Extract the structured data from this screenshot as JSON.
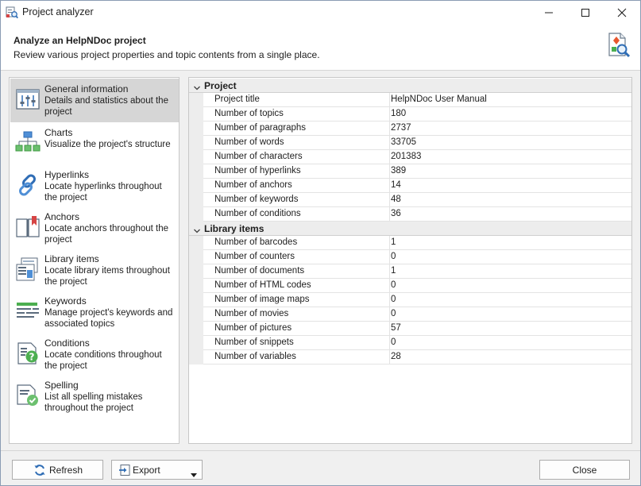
{
  "window": {
    "title": "Project analyzer"
  },
  "header": {
    "title": "Analyze an HelpNDoc project",
    "subtitle": "Review various project properties and topic contents from a single place."
  },
  "nav": {
    "items": [
      {
        "title": "General information",
        "description": "Details and statistics about the project",
        "icon": "sliders-icon",
        "selected": true
      },
      {
        "title": "Charts",
        "description": "Visualize the project's structure",
        "icon": "hierarchy-chart-icon"
      },
      {
        "title": "Hyperlinks",
        "description": "Locate hyperlinks throughout the project",
        "icon": "chain-link-icon"
      },
      {
        "title": "Anchors",
        "description": "Locate anchors throughout the project",
        "icon": "bookmark-book-icon"
      },
      {
        "title": "Library items",
        "description": "Locate library items throughout the project",
        "icon": "library-items-icon"
      },
      {
        "title": "Keywords",
        "description": "Manage project's keywords and associated topics",
        "icon": "keywords-icon"
      },
      {
        "title": "Conditions",
        "description": "Locate conditions throughout the project",
        "icon": "condition-question-icon"
      },
      {
        "title": "Spelling",
        "description": "List all spelling mistakes throughout the project",
        "icon": "spelling-check-icon"
      }
    ]
  },
  "grid": {
    "groups": [
      {
        "label": "Project",
        "rows": [
          {
            "name": "Project title",
            "value": "HelpNDoc User Manual"
          },
          {
            "name": "Number of topics",
            "value": "180"
          },
          {
            "name": "Number of paragraphs",
            "value": "2737"
          },
          {
            "name": "Number of words",
            "value": "33705"
          },
          {
            "name": "Number of characters",
            "value": "201383"
          },
          {
            "name": "Number of hyperlinks",
            "value": "389"
          },
          {
            "name": "Number of anchors",
            "value": "14"
          },
          {
            "name": "Number of keywords",
            "value": "48"
          },
          {
            "name": "Number of conditions",
            "value": "36"
          }
        ]
      },
      {
        "label": "Library items",
        "rows": [
          {
            "name": "Number of barcodes",
            "value": "1"
          },
          {
            "name": "Number of counters",
            "value": "0"
          },
          {
            "name": "Number of documents",
            "value": "1"
          },
          {
            "name": "Number of HTML codes",
            "value": "0"
          },
          {
            "name": "Number of image maps",
            "value": "0"
          },
          {
            "name": "Number of movies",
            "value": "0"
          },
          {
            "name": "Number of pictures",
            "value": "57"
          },
          {
            "name": "Number of snippets",
            "value": "0"
          },
          {
            "name": "Number of variables",
            "value": "28"
          }
        ]
      }
    ]
  },
  "footer": {
    "refresh_label": "Refresh",
    "export_label": "Export",
    "close_label": "Close"
  },
  "colors": {
    "selected_nav_bg": "#d6d6d6",
    "group_bg": "#ededed",
    "accent_blue": "#2f6db5",
    "accent_green": "#4caf50",
    "accent_red": "#d64545"
  }
}
